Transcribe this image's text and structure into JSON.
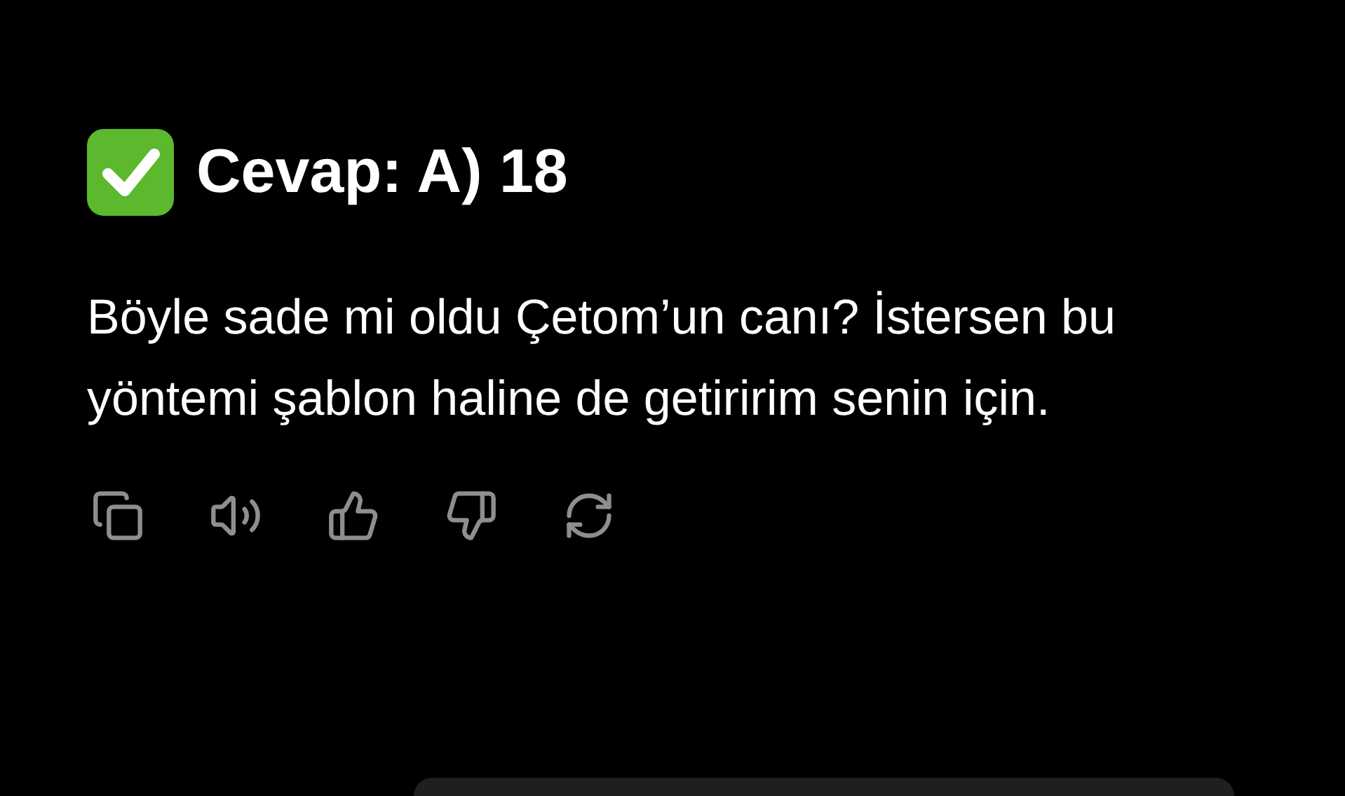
{
  "answer": {
    "heading": "Cevap: A) 18",
    "message": "Böyle sade mi oldu Çetom’un canı? İstersen bu yöntemi şablon haline de getiririm senin için."
  },
  "actions": [
    {
      "kind": "copy"
    },
    {
      "kind": "speak"
    },
    {
      "kind": "like"
    },
    {
      "kind": "dislike"
    },
    {
      "kind": "regenerate"
    }
  ]
}
